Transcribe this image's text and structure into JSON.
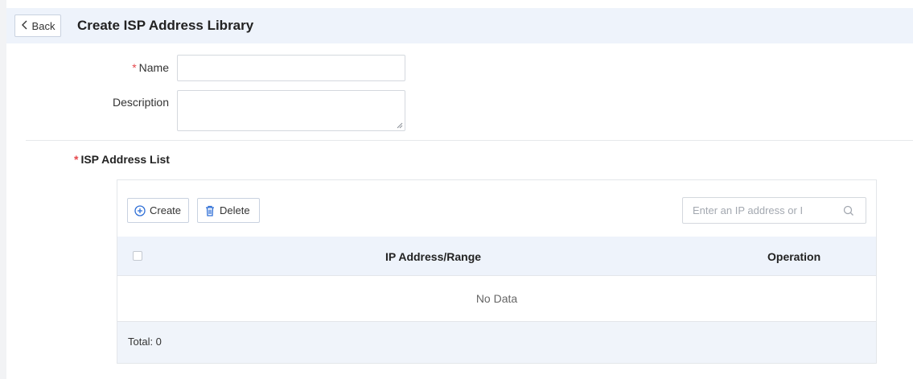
{
  "header": {
    "back_label": "Back",
    "title": "Create ISP Address Library"
  },
  "form": {
    "name_label": "Name",
    "name_value": "",
    "description_label": "Description",
    "description_value": "",
    "required_mark": "*"
  },
  "section": {
    "title": "ISP Address List"
  },
  "toolbar": {
    "create_label": "Create",
    "delete_label": "Delete",
    "search_placeholder": "Enter an IP address or I"
  },
  "table": {
    "columns": [
      "IP Address/Range",
      "Operation"
    ],
    "empty_text": "No Data",
    "total_text": "Total: 0"
  },
  "colors": {
    "accent": "#2f6fd6",
    "required": "#e5484d",
    "header_bg": "#eef3fb"
  }
}
